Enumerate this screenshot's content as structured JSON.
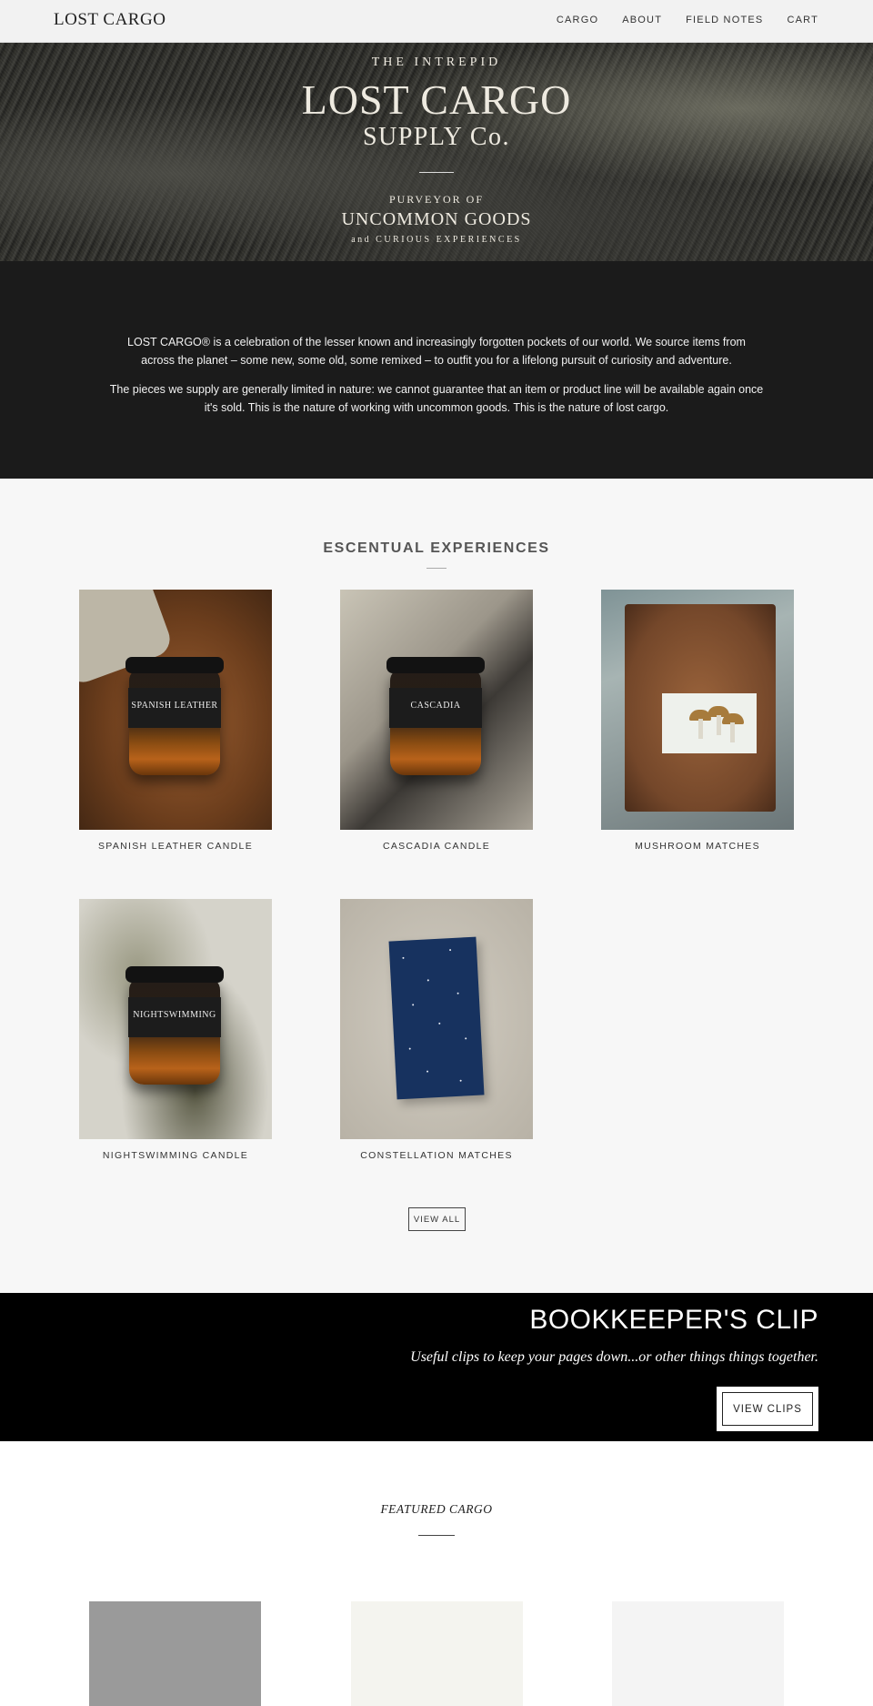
{
  "header": {
    "logo": "LOST CARGO",
    "nav": [
      "CARGO",
      "ABOUT",
      "FIELD NOTES",
      "CART"
    ]
  },
  "hero": {
    "kicker": "THE INTREPID",
    "title": "LOST CARGO",
    "subtitle": "SUPPLY Co.",
    "purveyor": "PURVEYOR OF",
    "goods": "UNCOMMON GOODS",
    "curious": "and CURIOUS EXPERIENCES"
  },
  "intro": {
    "p1": "LOST CARGO® is a celebration of the lesser known and increasingly forgotten pockets of our world. We source items from across the planet – some new, some old, some remixed – to outfit you for a lifelong pursuit of curiosity and adventure.",
    "p2": "The pieces we supply are generally limited in nature: we cannot guarantee that an item or product line will be available again once it's sold. This is the nature of working with uncommon goods. This is the nature of lost cargo."
  },
  "escentual": {
    "title": "ESCENTUAL EXPERIENCES",
    "products": [
      {
        "name": "SPANISH LEATHER CANDLE",
        "label": "SPANISH LEATHER"
      },
      {
        "name": "CASCADIA CANDLE",
        "label": "CASCADIA"
      },
      {
        "name": "MUSHROOM MATCHES"
      },
      {
        "name": "NIGHTSWIMMING CANDLE",
        "label": "NIGHTSWIMMING"
      },
      {
        "name": "CONSTELLATION MATCHES"
      }
    ],
    "view_all": "VIEW ALL"
  },
  "banner": {
    "title": "BOOKKEEPER'S CLIP",
    "subtitle": "Useful clips to keep your pages down...or other things things together.",
    "button": "VIEW CLIPS"
  },
  "featured": {
    "title": "FEATURED CARGO",
    "card_colors": [
      "#9a9a9a",
      "#f4f4ef",
      "#f4f4f4"
    ]
  }
}
